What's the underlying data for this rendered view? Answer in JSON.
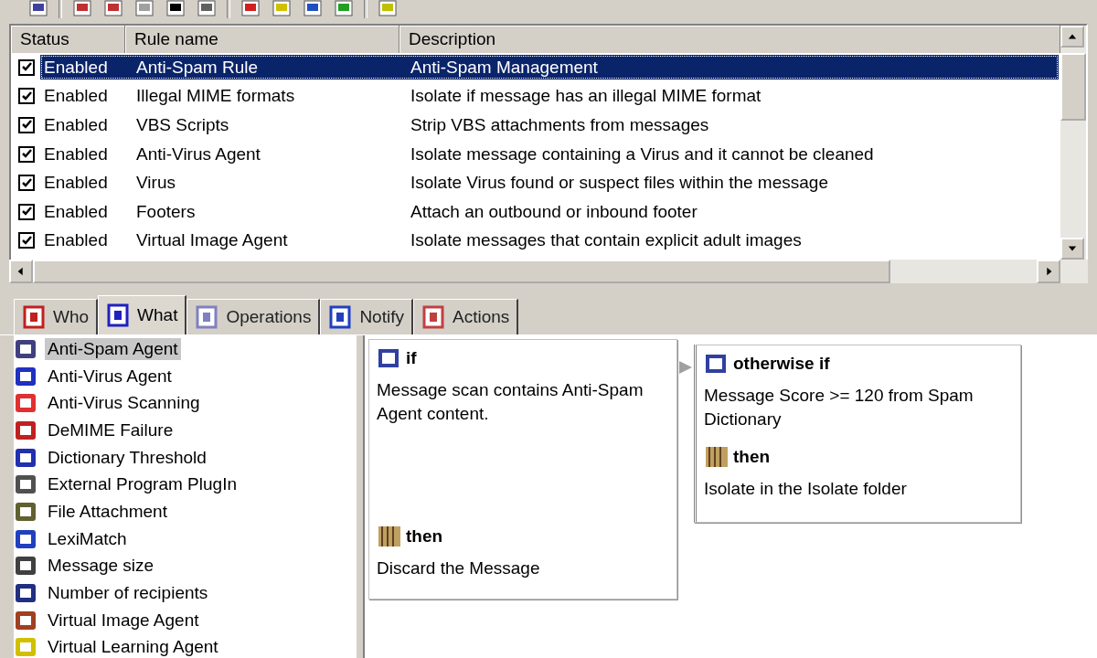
{
  "rules": {
    "columns": [
      "Status",
      "Rule name",
      "Description"
    ],
    "rows": [
      {
        "checked": true,
        "status": "Enabled",
        "name": "Anti-Spam Rule",
        "description": "Anti-Spam Management",
        "selected": true
      },
      {
        "checked": true,
        "status": "Enabled",
        "name": "Illegal MIME formats",
        "description": "Isolate if message has an illegal MIME format",
        "selected": false
      },
      {
        "checked": true,
        "status": "Enabled",
        "name": "VBS Scripts",
        "description": "Strip VBS attachments from messages",
        "selected": false
      },
      {
        "checked": true,
        "status": "Enabled",
        "name": "Anti-Virus Agent",
        "description": "Isolate message containing a Virus and it cannot be cleaned",
        "selected": false
      },
      {
        "checked": true,
        "status": "Enabled",
        "name": "Virus",
        "description": "Isolate Virus found or suspect files within the message",
        "selected": false
      },
      {
        "checked": true,
        "status": "Enabled",
        "name": "Footers",
        "description": "Attach an outbound or inbound footer",
        "selected": false
      },
      {
        "checked": true,
        "status": "Enabled",
        "name": "Virtual Image Agent",
        "description": "Isolate messages that contain explicit adult images",
        "selected": false
      }
    ]
  },
  "tabs": [
    {
      "label": "Who",
      "selected": false
    },
    {
      "label": "What",
      "selected": true
    },
    {
      "label": "Operations",
      "selected": false
    },
    {
      "label": "Notify",
      "selected": false
    },
    {
      "label": "Actions",
      "selected": false
    }
  ],
  "conditions": [
    {
      "label": "Anti-Spam Agent",
      "selected": true
    },
    {
      "label": "Anti-Virus Agent",
      "selected": false
    },
    {
      "label": "Anti-Virus Scanning",
      "selected": false
    },
    {
      "label": "DeMIME Failure",
      "selected": false
    },
    {
      "label": "Dictionary Threshold",
      "selected": false
    },
    {
      "label": "External Program PlugIn",
      "selected": false
    },
    {
      "label": "File Attachment",
      "selected": false
    },
    {
      "label": "LexiMatch",
      "selected": false
    },
    {
      "label": "Message size",
      "selected": false
    },
    {
      "label": "Number of recipients",
      "selected": false
    },
    {
      "label": "Virtual Image Agent",
      "selected": false
    },
    {
      "label": "Virtual Learning Agent",
      "selected": false
    }
  ],
  "blocks": [
    {
      "condition": {
        "heading": "if",
        "text": "Message scan contains Anti-Spam Agent content."
      },
      "action": {
        "heading": "then",
        "text": "Discard the Message"
      }
    },
    {
      "condition": {
        "heading": "otherwise if",
        "text": "Message Score >= 120 from Spam Dictionary"
      },
      "action": {
        "heading": "then",
        "text": "Isolate in the Isolate folder"
      }
    }
  ]
}
